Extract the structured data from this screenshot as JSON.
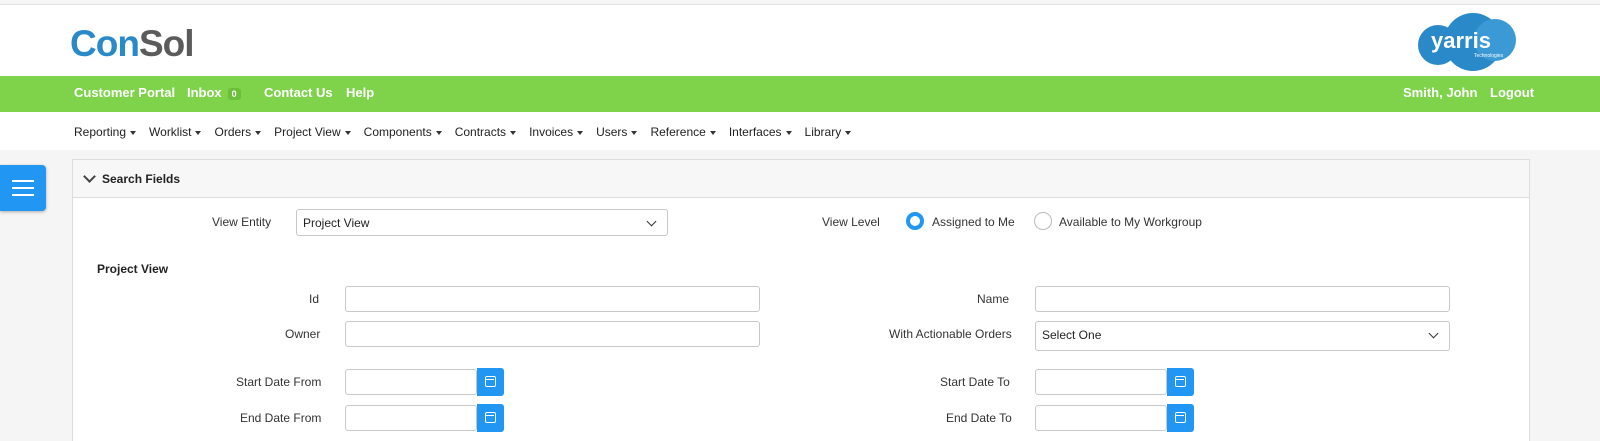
{
  "brand": {
    "consol_a": "Con",
    "consol_b": "Sol",
    "partner": "yarris",
    "partner_sub": "Technologies"
  },
  "topnav": {
    "customer_portal": "Customer Portal",
    "inbox": "Inbox",
    "inbox_count": "0",
    "contact": "Contact Us",
    "help": "Help",
    "user": "Smith, John",
    "logout": "Logout"
  },
  "menu": [
    "Reporting",
    "Worklist",
    "Orders",
    "Project View",
    "Components",
    "Contracts",
    "Invoices",
    "Users",
    "Reference",
    "Interfaces",
    "Library"
  ],
  "panel": {
    "title": "Search Fields",
    "view_entity_label": "View Entity",
    "view_entity_value": "Project View",
    "view_level_label": "View Level",
    "radio_assigned": "Assigned to Me",
    "radio_workgroup": "Available to My Workgroup",
    "selected_view_level": "Assigned to Me",
    "section_title": "Project View",
    "id_label": "Id",
    "id_value": "",
    "name_label": "Name",
    "name_value": "",
    "owner_label": "Owner",
    "owner_value": "",
    "actionable_label": "With Actionable Orders",
    "actionable_value": "Select One",
    "start_from_label": "Start Date From",
    "start_to_label": "Start Date To",
    "end_from_label": "End Date From",
    "end_to_label": "End Date To"
  },
  "colors": {
    "green": "#7ed34b",
    "accent_blue": "#2196f3",
    "brand_blue": "#2a8ac9"
  },
  "icons": {
    "menu": "hamburger-icon",
    "calendar": "calendar-icon",
    "collapse": "chevron-down-icon"
  }
}
